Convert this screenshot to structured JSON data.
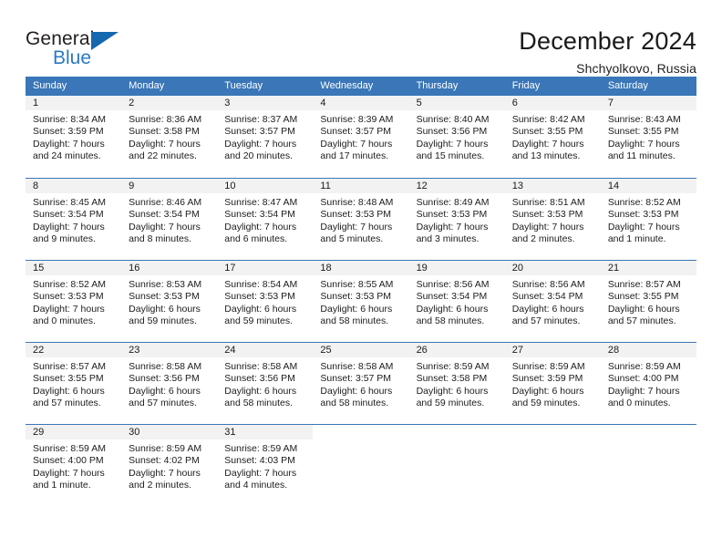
{
  "brand": {
    "name_top": "General",
    "name_bottom": "Blue",
    "triangle_color": "#1567b0",
    "blue_text_color": "#2a7ac0"
  },
  "header": {
    "title": "December 2024",
    "subtitle": "Shchyolkovo, Russia"
  },
  "theme": {
    "header_bar_color": "#3a76b8",
    "day_band_color": "#f2f2f2",
    "row_divider_color": "#3a76b8",
    "text_color": "#1c1c1c"
  },
  "weekdays": [
    "Sunday",
    "Monday",
    "Tuesday",
    "Wednesday",
    "Thursday",
    "Friday",
    "Saturday"
  ],
  "weeks": [
    [
      {
        "day": "1",
        "sunrise": "Sunrise: 8:34 AM",
        "sunset": "Sunset: 3:59 PM",
        "daylight_line1": "Daylight: 7 hours",
        "daylight_line2": "and 24 minutes."
      },
      {
        "day": "2",
        "sunrise": "Sunrise: 8:36 AM",
        "sunset": "Sunset: 3:58 PM",
        "daylight_line1": "Daylight: 7 hours",
        "daylight_line2": "and 22 minutes."
      },
      {
        "day": "3",
        "sunrise": "Sunrise: 8:37 AM",
        "sunset": "Sunset: 3:57 PM",
        "daylight_line1": "Daylight: 7 hours",
        "daylight_line2": "and 20 minutes."
      },
      {
        "day": "4",
        "sunrise": "Sunrise: 8:39 AM",
        "sunset": "Sunset: 3:57 PM",
        "daylight_line1": "Daylight: 7 hours",
        "daylight_line2": "and 17 minutes."
      },
      {
        "day": "5",
        "sunrise": "Sunrise: 8:40 AM",
        "sunset": "Sunset: 3:56 PM",
        "daylight_line1": "Daylight: 7 hours",
        "daylight_line2": "and 15 minutes."
      },
      {
        "day": "6",
        "sunrise": "Sunrise: 8:42 AM",
        "sunset": "Sunset: 3:55 PM",
        "daylight_line1": "Daylight: 7 hours",
        "daylight_line2": "and 13 minutes."
      },
      {
        "day": "7",
        "sunrise": "Sunrise: 8:43 AM",
        "sunset": "Sunset: 3:55 PM",
        "daylight_line1": "Daylight: 7 hours",
        "daylight_line2": "and 11 minutes."
      }
    ],
    [
      {
        "day": "8",
        "sunrise": "Sunrise: 8:45 AM",
        "sunset": "Sunset: 3:54 PM",
        "daylight_line1": "Daylight: 7 hours",
        "daylight_line2": "and 9 minutes."
      },
      {
        "day": "9",
        "sunrise": "Sunrise: 8:46 AM",
        "sunset": "Sunset: 3:54 PM",
        "daylight_line1": "Daylight: 7 hours",
        "daylight_line2": "and 8 minutes."
      },
      {
        "day": "10",
        "sunrise": "Sunrise: 8:47 AM",
        "sunset": "Sunset: 3:54 PM",
        "daylight_line1": "Daylight: 7 hours",
        "daylight_line2": "and 6 minutes."
      },
      {
        "day": "11",
        "sunrise": "Sunrise: 8:48 AM",
        "sunset": "Sunset: 3:53 PM",
        "daylight_line1": "Daylight: 7 hours",
        "daylight_line2": "and 5 minutes."
      },
      {
        "day": "12",
        "sunrise": "Sunrise: 8:49 AM",
        "sunset": "Sunset: 3:53 PM",
        "daylight_line1": "Daylight: 7 hours",
        "daylight_line2": "and 3 minutes."
      },
      {
        "day": "13",
        "sunrise": "Sunrise: 8:51 AM",
        "sunset": "Sunset: 3:53 PM",
        "daylight_line1": "Daylight: 7 hours",
        "daylight_line2": "and 2 minutes."
      },
      {
        "day": "14",
        "sunrise": "Sunrise: 8:52 AM",
        "sunset": "Sunset: 3:53 PM",
        "daylight_line1": "Daylight: 7 hours",
        "daylight_line2": "and 1 minute."
      }
    ],
    [
      {
        "day": "15",
        "sunrise": "Sunrise: 8:52 AM",
        "sunset": "Sunset: 3:53 PM",
        "daylight_line1": "Daylight: 7 hours",
        "daylight_line2": "and 0 minutes."
      },
      {
        "day": "16",
        "sunrise": "Sunrise: 8:53 AM",
        "sunset": "Sunset: 3:53 PM",
        "daylight_line1": "Daylight: 6 hours",
        "daylight_line2": "and 59 minutes."
      },
      {
        "day": "17",
        "sunrise": "Sunrise: 8:54 AM",
        "sunset": "Sunset: 3:53 PM",
        "daylight_line1": "Daylight: 6 hours",
        "daylight_line2": "and 59 minutes."
      },
      {
        "day": "18",
        "sunrise": "Sunrise: 8:55 AM",
        "sunset": "Sunset: 3:53 PM",
        "daylight_line1": "Daylight: 6 hours",
        "daylight_line2": "and 58 minutes."
      },
      {
        "day": "19",
        "sunrise": "Sunrise: 8:56 AM",
        "sunset": "Sunset: 3:54 PM",
        "daylight_line1": "Daylight: 6 hours",
        "daylight_line2": "and 58 minutes."
      },
      {
        "day": "20",
        "sunrise": "Sunrise: 8:56 AM",
        "sunset": "Sunset: 3:54 PM",
        "daylight_line1": "Daylight: 6 hours",
        "daylight_line2": "and 57 minutes."
      },
      {
        "day": "21",
        "sunrise": "Sunrise: 8:57 AM",
        "sunset": "Sunset: 3:55 PM",
        "daylight_line1": "Daylight: 6 hours",
        "daylight_line2": "and 57 minutes."
      }
    ],
    [
      {
        "day": "22",
        "sunrise": "Sunrise: 8:57 AM",
        "sunset": "Sunset: 3:55 PM",
        "daylight_line1": "Daylight: 6 hours",
        "daylight_line2": "and 57 minutes."
      },
      {
        "day": "23",
        "sunrise": "Sunrise: 8:58 AM",
        "sunset": "Sunset: 3:56 PM",
        "daylight_line1": "Daylight: 6 hours",
        "daylight_line2": "and 57 minutes."
      },
      {
        "day": "24",
        "sunrise": "Sunrise: 8:58 AM",
        "sunset": "Sunset: 3:56 PM",
        "daylight_line1": "Daylight: 6 hours",
        "daylight_line2": "and 58 minutes."
      },
      {
        "day": "25",
        "sunrise": "Sunrise: 8:58 AM",
        "sunset": "Sunset: 3:57 PM",
        "daylight_line1": "Daylight: 6 hours",
        "daylight_line2": "and 58 minutes."
      },
      {
        "day": "26",
        "sunrise": "Sunrise: 8:59 AM",
        "sunset": "Sunset: 3:58 PM",
        "daylight_line1": "Daylight: 6 hours",
        "daylight_line2": "and 59 minutes."
      },
      {
        "day": "27",
        "sunrise": "Sunrise: 8:59 AM",
        "sunset": "Sunset: 3:59 PM",
        "daylight_line1": "Daylight: 6 hours",
        "daylight_line2": "and 59 minutes."
      },
      {
        "day": "28",
        "sunrise": "Sunrise: 8:59 AM",
        "sunset": "Sunset: 4:00 PM",
        "daylight_line1": "Daylight: 7 hours",
        "daylight_line2": "and 0 minutes."
      }
    ],
    [
      {
        "day": "29",
        "sunrise": "Sunrise: 8:59 AM",
        "sunset": "Sunset: 4:00 PM",
        "daylight_line1": "Daylight: 7 hours",
        "daylight_line2": "and 1 minute."
      },
      {
        "day": "30",
        "sunrise": "Sunrise: 8:59 AM",
        "sunset": "Sunset: 4:02 PM",
        "daylight_line1": "Daylight: 7 hours",
        "daylight_line2": "and 2 minutes."
      },
      {
        "day": "31",
        "sunrise": "Sunrise: 8:59 AM",
        "sunset": "Sunset: 4:03 PM",
        "daylight_line1": "Daylight: 7 hours",
        "daylight_line2": "and 4 minutes."
      },
      {
        "day": "",
        "sunrise": "",
        "sunset": "",
        "daylight_line1": "",
        "daylight_line2": ""
      },
      {
        "day": "",
        "sunrise": "",
        "sunset": "",
        "daylight_line1": "",
        "daylight_line2": ""
      },
      {
        "day": "",
        "sunrise": "",
        "sunset": "",
        "daylight_line1": "",
        "daylight_line2": ""
      },
      {
        "day": "",
        "sunrise": "",
        "sunset": "",
        "daylight_line1": "",
        "daylight_line2": ""
      }
    ]
  ]
}
